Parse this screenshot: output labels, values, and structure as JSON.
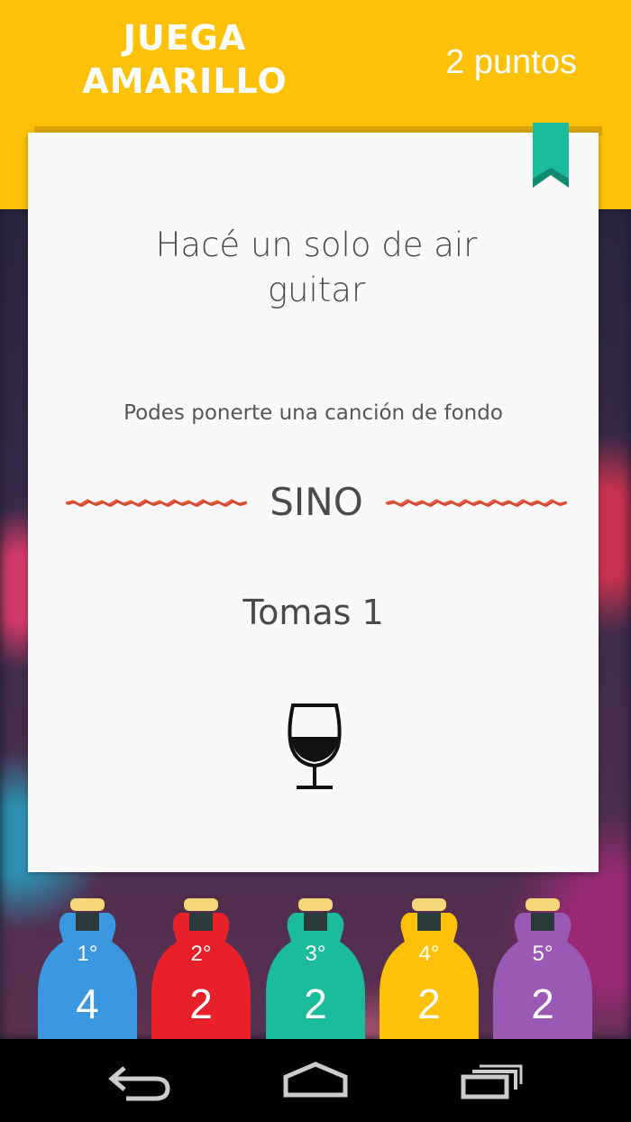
{
  "header": {
    "title_line1": "JUEGA",
    "title_line2": "AMARILLO",
    "points": "2 puntos",
    "color": "#ffc107"
  },
  "card": {
    "challenge": "Hacé un solo de air guitar",
    "hint": "Podes ponerte una canción de fondo",
    "alternative": "SINO",
    "penalty": "Tomas 1",
    "bookmark_color": "#1abc9c",
    "icon": "wine-glass-icon"
  },
  "players": [
    {
      "rank": "1°",
      "score": "4",
      "color": "#3a97e0"
    },
    {
      "rank": "2°",
      "score": "2",
      "color": "#e8202a"
    },
    {
      "rank": "3°",
      "score": "2",
      "color": "#1abc9c"
    },
    {
      "rank": "4°",
      "score": "2",
      "color": "#ffc107"
    },
    {
      "rank": "5°",
      "score": "2",
      "color": "#9b59b6"
    }
  ],
  "navbar": {
    "back": "back-icon",
    "home": "home-icon",
    "recents": "recents-icon"
  }
}
